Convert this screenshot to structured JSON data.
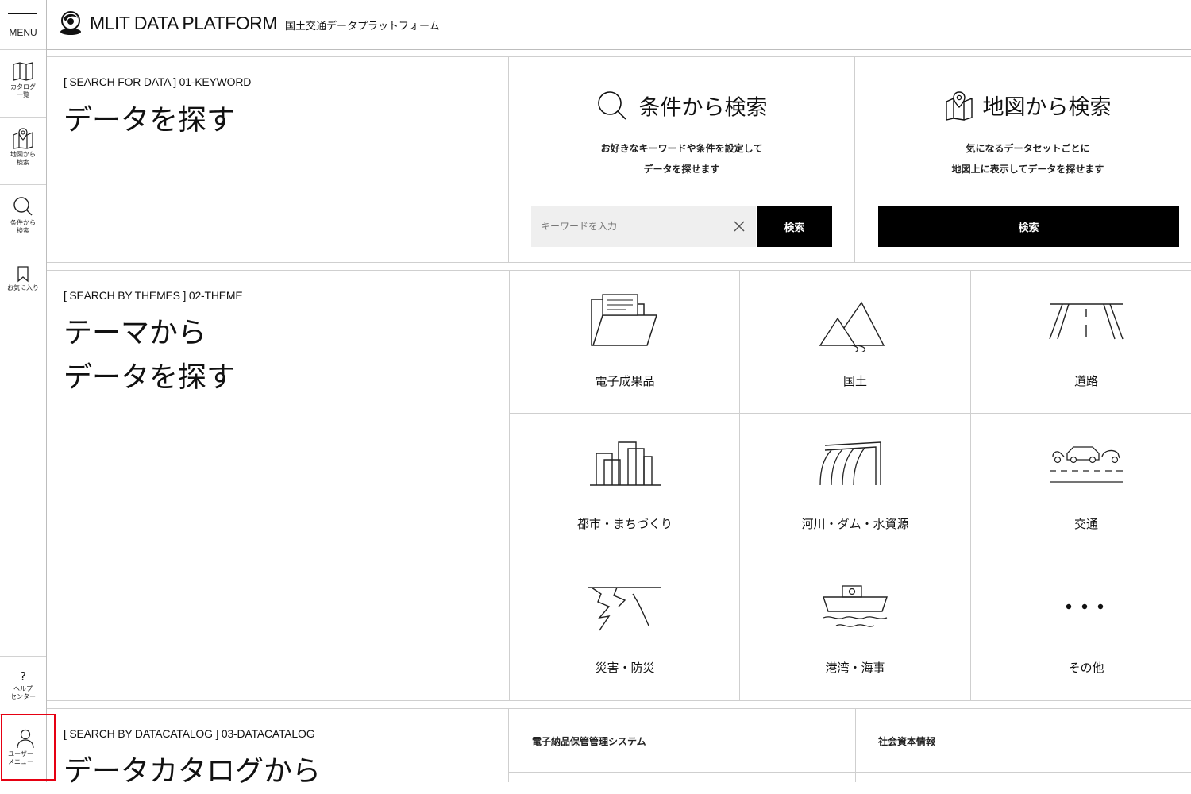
{
  "sidebar": {
    "menu_label": "MENU",
    "items": [
      {
        "label": "カタログ\n一覧",
        "icon": "book-open-icon"
      },
      {
        "label": "地図から\n検索",
        "icon": "map-pin-icon"
      },
      {
        "label": "条件から\n検索",
        "icon": "search-icon"
      },
      {
        "label": "お気に入り",
        "icon": "bookmark-icon"
      }
    ],
    "help": {
      "symbol": "?",
      "label": "ヘルプ\nセンター"
    },
    "user": {
      "label": "ユーザー\nメニュー",
      "icon": "user-icon"
    }
  },
  "header": {
    "title": "MLIT DATA PLATFORM",
    "subtitle": "国土交通データプラットフォーム"
  },
  "keyword_section": {
    "label": "[ SEARCH FOR DATA ] 01-KEYWORD",
    "title": "データを探す"
  },
  "condition_search": {
    "title": "条件から検索",
    "description": "お好きなキーワードや条件を設定して\nデータを探せます",
    "input_placeholder": "キーワードを入力",
    "input_value": "",
    "button_label": "検索"
  },
  "map_search": {
    "title": "地図から検索",
    "description": "気になるデータセットごとに\n地図上に表示してデータを探せます",
    "button_label": "検索"
  },
  "theme_section": {
    "label": "[ SEARCH BY THEMES ] 02-THEME",
    "title": "テーマから\nデータを探す",
    "themes": [
      {
        "label": "電子成果品",
        "icon": "folder-icon"
      },
      {
        "label": "国土",
        "icon": "mountain-icon"
      },
      {
        "label": "道路",
        "icon": "road-icon"
      },
      {
        "label": "都市・まちづくり",
        "icon": "city-buildings-icon"
      },
      {
        "label": "河川・ダム・水資源",
        "icon": "dam-icon"
      },
      {
        "label": "交通",
        "icon": "traffic-cars-icon"
      },
      {
        "label": "災害・防災",
        "icon": "disaster-crack-icon"
      },
      {
        "label": "港湾・海事",
        "icon": "ship-icon"
      },
      {
        "label": "その他",
        "icon": "more-dots-icon"
      }
    ]
  },
  "catalog_section": {
    "label": "[ SEARCH BY DATACATALOG ] 03-DATACATALOG",
    "title": "データカタログから",
    "items": [
      "電子納品保管管理システム",
      "社会資本情報"
    ]
  }
}
